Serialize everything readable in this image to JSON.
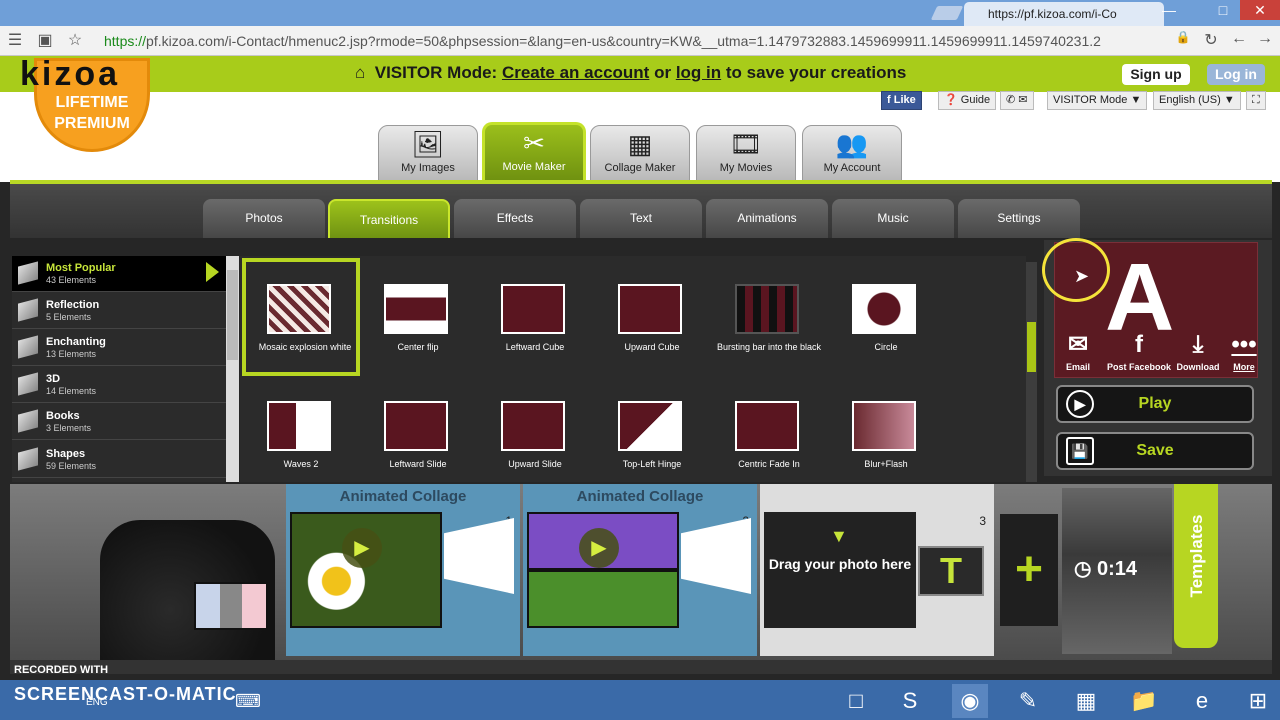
{
  "browser": {
    "tab_title": "https://pf.kizoa.com/i-Co",
    "url_scheme": "https://",
    "url_rest": "pf.kizoa.com/i-Contact/hmenuc2.jsp?rmode=50&phpsession=&lang=en-us&country=KW&__utma=1.1479732883.1459699911.1459699911.1459740231.2",
    "nav_icons": [
      "menu-icon",
      "home-icon",
      "star-icon",
      "lock-icon",
      "reload-icon",
      "back-icon",
      "forward-icon"
    ]
  },
  "header": {
    "logo": "kizoa",
    "badge_line1": "LIFETIME",
    "badge_line2": "PREMIUM",
    "visitor_label": "VISITOR Mode:",
    "create_account": "Create an account",
    "or": "or",
    "log_in": "log in",
    "suffix": "to save your creations",
    "signup": "Sign up",
    "login": "Log in",
    "like": "Like",
    "guide": "Guide",
    "visitor_select": "VISITOR Mode",
    "language": "English (US)"
  },
  "main_tabs": [
    {
      "label": "My Images",
      "icon": "images-icon"
    },
    {
      "label": "Movie Maker",
      "icon": "movie-maker-icon"
    },
    {
      "label": "Collage Maker",
      "icon": "collage-icon"
    },
    {
      "label": "My Movies",
      "icon": "film-icon"
    },
    {
      "label": "My Account",
      "icon": "users-icon"
    }
  ],
  "sub_tabs": [
    "Photos",
    "Transitions",
    "Effects",
    "Text",
    "Animations",
    "Music",
    "Settings"
  ],
  "active_main_tab": "Movie Maker",
  "active_sub_tab": "Transitions",
  "categories": [
    {
      "name": "Most Popular",
      "count": "43 Elements"
    },
    {
      "name": "Reflection",
      "count": "5 Elements"
    },
    {
      "name": "Enchanting",
      "count": "13 Elements"
    },
    {
      "name": "3D",
      "count": "14 Elements"
    },
    {
      "name": "Books",
      "count": "3 Elements"
    },
    {
      "name": "Shapes",
      "count": "59 Elements"
    }
  ],
  "transitions": [
    {
      "label": "Mosaic explosion white"
    },
    {
      "label": "Center flip"
    },
    {
      "label": "Leftward Cube"
    },
    {
      "label": "Upward Cube"
    },
    {
      "label": "Bursting bar into the black"
    },
    {
      "label": "Circle"
    },
    {
      "label": "Waves 2"
    },
    {
      "label": "Leftward Slide"
    },
    {
      "label": "Upward Slide"
    },
    {
      "label": "Top-Left Hinge"
    },
    {
      "label": "Centric Fade In"
    },
    {
      "label": "Blur+Flash"
    }
  ],
  "preview": {
    "letter": "A",
    "email": "Email",
    "post_facebook": "Post Facebook",
    "download": "Download",
    "more": "More",
    "play": "Play",
    "save": "Save"
  },
  "timeline": {
    "slot1_title": "Animated Collage",
    "slot1_num": "1",
    "slot2_title": "Animated Collage",
    "slot2_num": "2",
    "slot3_num": "3",
    "drag": "Drag your photo here",
    "text_button": "T",
    "add": "+",
    "duration": "0:14",
    "templates": "Templates"
  },
  "recorder": {
    "recorded_with": "RECORDED WITH",
    "brand": "SCREENCAST-O-MATIC",
    "lang": "ENG"
  },
  "colors": {
    "brand_green": "#a8cc1a",
    "accent_green": "#b7d622",
    "badge_orange": "#f7a01f",
    "preview_bg": "#5b1a22"
  }
}
